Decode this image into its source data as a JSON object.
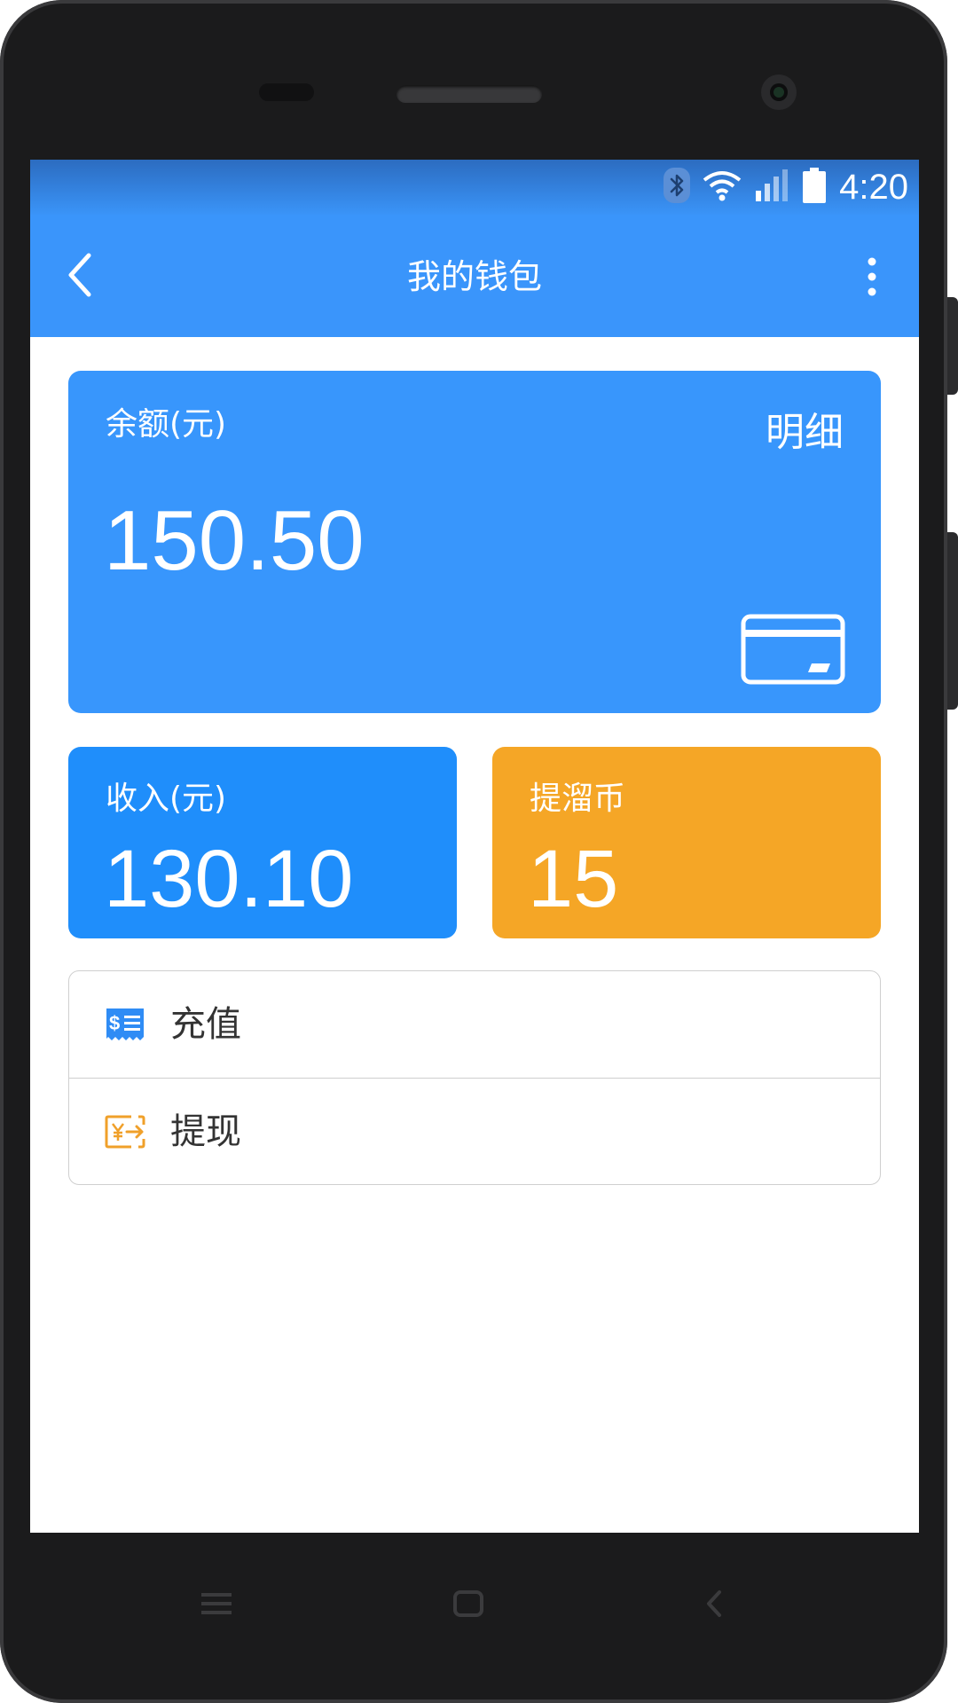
{
  "status_bar": {
    "time": "4:20",
    "icons": [
      "bluetooth-icon",
      "wifi-icon",
      "signal-icon",
      "battery-icon"
    ]
  },
  "app_bar": {
    "title": "我的钱包",
    "back_icon": "chevron-left-icon",
    "more_icon": "more-vertical-icon"
  },
  "balance_card": {
    "label": "余额(元)",
    "value": "150.50",
    "detail_label": "明细",
    "icon": "bank-card-icon"
  },
  "stats": {
    "income": {
      "label": "收入(元)",
      "value": "130.10"
    },
    "coins": {
      "label": "提溜币",
      "value": "15"
    }
  },
  "actions": [
    {
      "label": "充值",
      "icon": "recharge-receipt-icon"
    },
    {
      "label": "提现",
      "icon": "withdraw-yuan-icon"
    }
  ],
  "nav_keys": [
    "menu-icon",
    "home-icon",
    "back-icon"
  ],
  "colors": {
    "primary": "#3a95fb",
    "income": "#1f8efb",
    "coins": "#f5a626",
    "recharge_icon": "#2f8cf5",
    "withdraw_icon": "#f0a02a"
  }
}
